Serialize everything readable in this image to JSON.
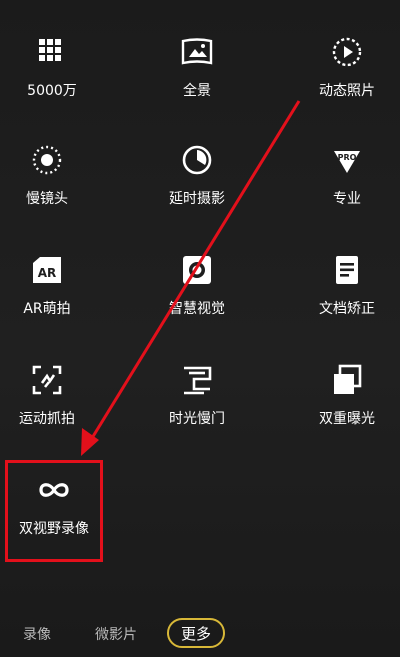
{
  "modes": [
    {
      "label": "5000万",
      "icon": "grid-icon"
    },
    {
      "label": "全景",
      "icon": "panorama-icon"
    },
    {
      "label": "动态照片",
      "icon": "moving-picture-icon"
    },
    {
      "label": "慢镜头",
      "icon": "slow-motion-icon"
    },
    {
      "label": "延时摄影",
      "icon": "time-lapse-icon"
    },
    {
      "label": "专业",
      "icon": "pro-icon"
    },
    {
      "label": "AR萌拍",
      "icon": "ar-icon"
    },
    {
      "label": "智慧视觉",
      "icon": "smart-vision-icon"
    },
    {
      "label": "文档矫正",
      "icon": "document-icon"
    },
    {
      "label": "运动抓拍",
      "icon": "motion-capture-icon"
    },
    {
      "label": "时光慢门",
      "icon": "light-painting-icon"
    },
    {
      "label": "双重曝光",
      "icon": "double-exposure-icon"
    },
    {
      "label": "双视野录像",
      "icon": "dual-view-icon"
    }
  ],
  "bottom_tabs": {
    "video": "录像",
    "micro_film": "微影片",
    "more": "更多"
  },
  "colors": {
    "annotation": "#e3101b",
    "active_tab_border": "#d8b838"
  }
}
